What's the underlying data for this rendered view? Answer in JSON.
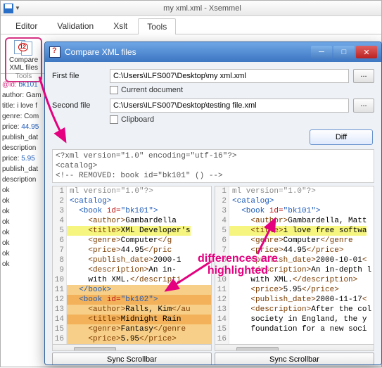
{
  "app": {
    "title": "my xml.xml - Xsemmel",
    "menu": [
      "Editor",
      "Validation",
      "Xslt",
      "Tools"
    ],
    "active_menu": "Tools",
    "ribbon": {
      "compare_btn_line1": "Compare",
      "compare_btn_line2": "XML files",
      "group_label": "Tools"
    }
  },
  "dialog": {
    "title": "Compare XML files",
    "first_label": "First file",
    "first_value": "C:\\Users\\ILFS007\\Desktop\\my xml.xml",
    "current_doc": "Current document",
    "second_label": "Second file",
    "second_value": "C:\\Users\\ILFS007\\Desktop\\testing file.xml",
    "clipboard": "Clipboard",
    "diff_button": "Diff",
    "sync_button": "Sync Scrollbar",
    "browse": "...",
    "header_lines": [
      "<?xml version=\"1.0\" encoding=\"utf-16\"?>",
      "<catalog>",
      "  <!-- REMOVED: book id=\"bk101\" () -->"
    ]
  },
  "left_list": [
    "",
    "@id: bk101",
    "author: Gam",
    "title: i love f",
    "genre: Com",
    "price: 44.95",
    "publish_dat",
    "description",
    "",
    "price: 5.95",
    "publish_dat",
    "description",
    "ok",
    "ok",
    "ok",
    "ok",
    "ok",
    "ok",
    "ok",
    "ok"
  ],
  "pane_left": [
    {
      "n": 1,
      "cls": "",
      "html": "<span class='t-gray'>ml version=\"1.0\"?&gt;</span>"
    },
    {
      "n": 2,
      "cls": "",
      "html": "<span class='t-blue'>&lt;catalog&gt;</span>"
    },
    {
      "n": 3,
      "cls": "",
      "html": "  <span class='t-blue'>&lt;book </span><span class='t-red'>id=</span><span class='t-blue'>\"bk101\"&gt;</span>"
    },
    {
      "n": 4,
      "cls": "",
      "html": "    <span class='t-brown'>&lt;author&gt;</span>Gambardella"
    },
    {
      "n": 5,
      "cls": "hl-y",
      "html": "    <span class='t-brown'>&lt;title&gt;</span>XML Developer's"
    },
    {
      "n": 6,
      "cls": "",
      "html": "    <span class='t-brown'>&lt;genre&gt;</span>Computer<span class='t-brown'>&lt;/g</span>"
    },
    {
      "n": 7,
      "cls": "",
      "html": "    <span class='t-brown'>&lt;price&gt;</span>44.95<span class='t-brown'>&lt;/pric</span>"
    },
    {
      "n": 8,
      "cls": "",
      "html": "    <span class='t-brown'>&lt;publish_date&gt;</span>2000-1"
    },
    {
      "n": 9,
      "cls": "",
      "html": "    <span class='t-brown'>&lt;description&gt;</span>An in-"
    },
    {
      "n": 10,
      "cls": "",
      "html": "    with XML.<span class='t-brown'>&lt;/descripti</span>"
    },
    {
      "n": 11,
      "cls": "hl-o1",
      "html": "  <span class='t-blue'>&lt;/book&gt;</span>"
    },
    {
      "n": 12,
      "cls": "hl-o2",
      "html": "  <span class='t-blue'>&lt;book </span><span class='t-red'>id=</span><span class='t-blue'>\"bk102\"&gt;</span>"
    },
    {
      "n": 13,
      "cls": "hl-o1",
      "html": "    <span class='t-brown'>&lt;author&gt;</span>Ralls, Kim<span class='t-brown'>&lt;/au</span>"
    },
    {
      "n": 14,
      "cls": "hl-o2",
      "html": "    <span class='t-brown'>&lt;title&gt;</span>Midnight Rain"
    },
    {
      "n": 15,
      "cls": "hl-o1",
      "html": "    <span class='t-brown'>&lt;genre&gt;</span>Fantasy<span class='t-brown'>&lt;/genre</span>"
    },
    {
      "n": 16,
      "cls": "hl-o3",
      "html": "    <span class='t-brown'>&lt;price&gt;</span>5.95<span class='t-brown'>&lt;/price&gt;</span>"
    }
  ],
  "pane_right": [
    {
      "n": 1,
      "cls": "",
      "html": "<span class='t-gray'>ml version=\"1.0\"?&gt;</span>"
    },
    {
      "n": 2,
      "cls": "",
      "html": "<span class='t-blue'>&lt;catalog&gt;</span>"
    },
    {
      "n": 3,
      "cls": "",
      "html": "  <span class='t-blue'>&lt;book </span><span class='t-red'>id=</span><span class='t-blue'>\"bk101\"&gt;</span>"
    },
    {
      "n": 4,
      "cls": "",
      "html": "    <span class='t-brown'>&lt;author&gt;</span>Gambardella, Matt"
    },
    {
      "n": 5,
      "cls": "hl-y",
      "html": "    <span class='t-brown'>&lt;title&gt;</span>i love free softwa"
    },
    {
      "n": 6,
      "cls": "",
      "html": "    <span class='t-brown'>&lt;genre&gt;</span>Computer<span class='t-brown'>&lt;/genre</span>"
    },
    {
      "n": 7,
      "cls": "",
      "html": "    <span class='t-brown'>&lt;price&gt;</span>44.95<span class='t-brown'>&lt;/price&gt;</span>"
    },
    {
      "n": 8,
      "cls": "",
      "html": "    <span class='t-brown'>&lt;publish_date&gt;</span>2000-10-01<span class='t-brown'>&lt;</span>"
    },
    {
      "n": 9,
      "cls": "",
      "html": "    <span class='t-brown'>&lt;description&gt;</span>An in-depth l"
    },
    {
      "n": 10,
      "cls": "",
      "html": "    with XML.<span class='t-brown'>&lt;/description&gt;</span>"
    },
    {
      "n": 11,
      "cls": "",
      "html": "    <span class='t-brown'>&lt;price&gt;</span>5.95<span class='t-brown'>&lt;/price&gt;</span>"
    },
    {
      "n": 12,
      "cls": "",
      "html": "    <span class='t-brown'>&lt;publish_date&gt;</span>2000-11-17<span class='t-brown'>&lt;</span>"
    },
    {
      "n": 13,
      "cls": "",
      "html": "    <span class='t-brown'>&lt;description&gt;</span>After the col"
    },
    {
      "n": 14,
      "cls": "",
      "html": "    society in England, the y"
    },
    {
      "n": 15,
      "cls": "",
      "html": "    foundation for a new soci"
    },
    {
      "n": 16,
      "cls": "",
      "html": " "
    }
  ],
  "annotation": "differences are\nhighlighted"
}
